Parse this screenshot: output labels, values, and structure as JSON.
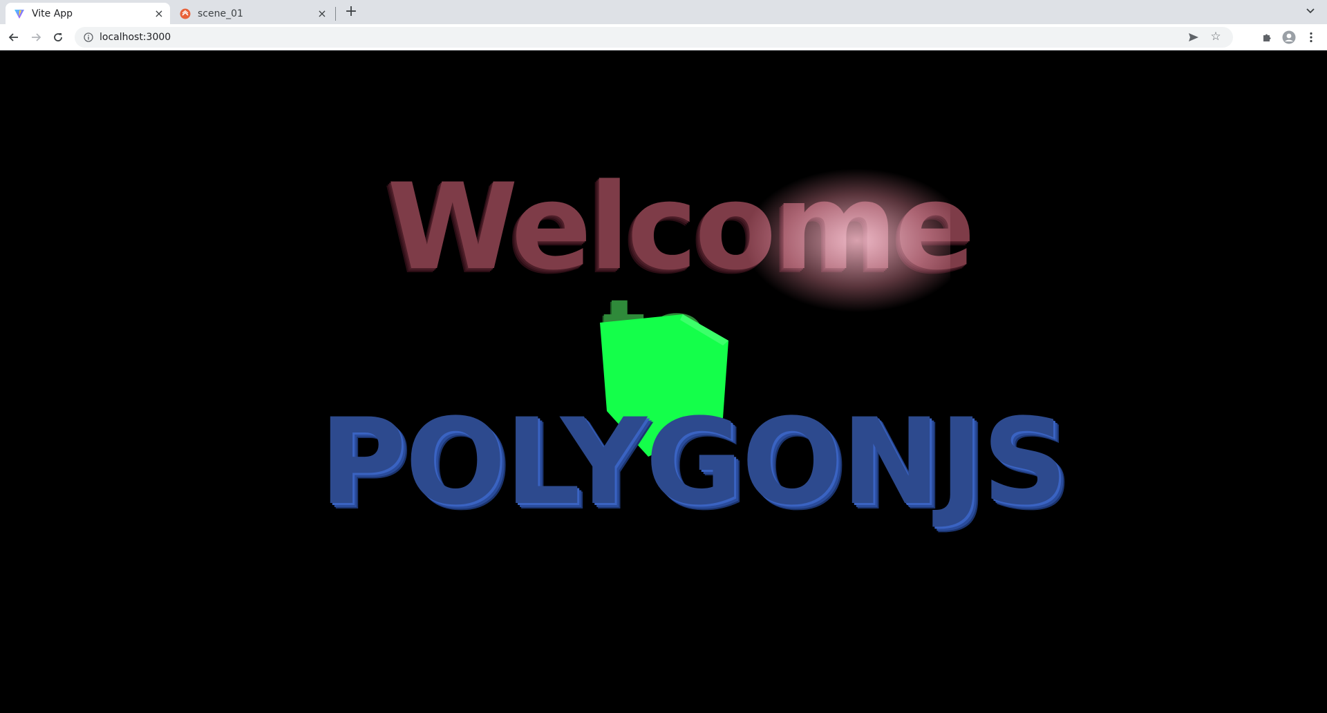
{
  "browser": {
    "tabs": [
      {
        "title": "Vite App",
        "active": true,
        "favicon": "vite-logo-icon"
      },
      {
        "title": "scene_01",
        "active": false,
        "favicon": "polygonjs-logo-icon"
      }
    ],
    "address": "localhost:3000"
  },
  "scene": {
    "line1": "Welcome",
    "line2": "to",
    "line3": "POLYGONJS",
    "colors": {
      "background": "#000000",
      "welcome": "#7e3c48",
      "to": "#2f8a3a",
      "polygonjs": "#2d4a8e",
      "cube": "#14ff4a"
    }
  }
}
